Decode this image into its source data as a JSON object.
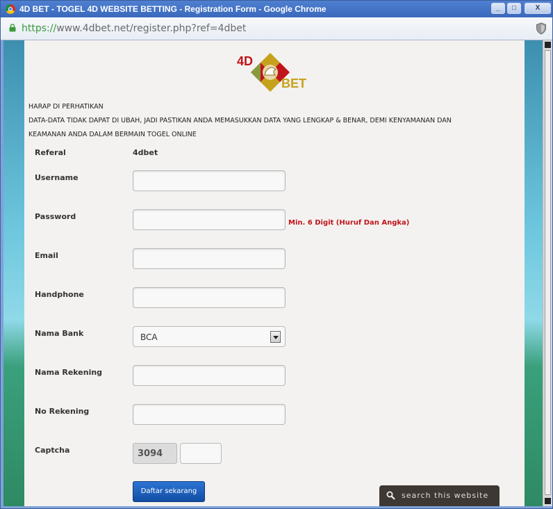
{
  "window": {
    "title": "4D BET - TOGEL 4D WEBSITE BETTING - Registration Form - Google Chrome",
    "minimize_glyph": "_",
    "maximize_glyph": "□",
    "close_glyph": "X"
  },
  "address": {
    "scheme": "https://",
    "rest": "www.4dbet.net/register.php?ref=4dbet"
  },
  "logo": {
    "text_top": "4D",
    "text_bottom": "BET",
    "colors": {
      "red": "#c0141b",
      "gold": "#c6a11c",
      "green": "#7cb342"
    }
  },
  "notice": {
    "heading": "HARAP DI PERHATIKAN",
    "line1": "DATA-DATA TIDAK DAPAT DI UBAH, JADI PASTIKAN ANDA MEMASUKKAN DATA YANG LENGKAP & BENAR, DEMI KENYAMANAN DAN",
    "line2": "KEAMANAN ANDA DALAM BERMAIN TOGEL ONLINE"
  },
  "form": {
    "referal_label": "Referal",
    "referal_value": "4dbet",
    "username_label": "Username",
    "username_value": "",
    "password_label": "Password",
    "password_value": "",
    "password_hint": "Min. 6 Digit (Huruf Dan Angka)",
    "email_label": "Email",
    "email_value": "",
    "handphone_label": "Handphone",
    "handphone_value": "",
    "bank_label": "Nama Bank",
    "bank_selected": "BCA",
    "rekening_name_label": "Nama Rekening",
    "rekening_name_value": "",
    "rekening_no_label": "No Rekening",
    "rekening_no_value": "",
    "captcha_label": "Captcha",
    "captcha_code": "3094",
    "captcha_value": "",
    "submit_label": "Daftar sekarang"
  },
  "search_widget": {
    "label": "search this website"
  }
}
